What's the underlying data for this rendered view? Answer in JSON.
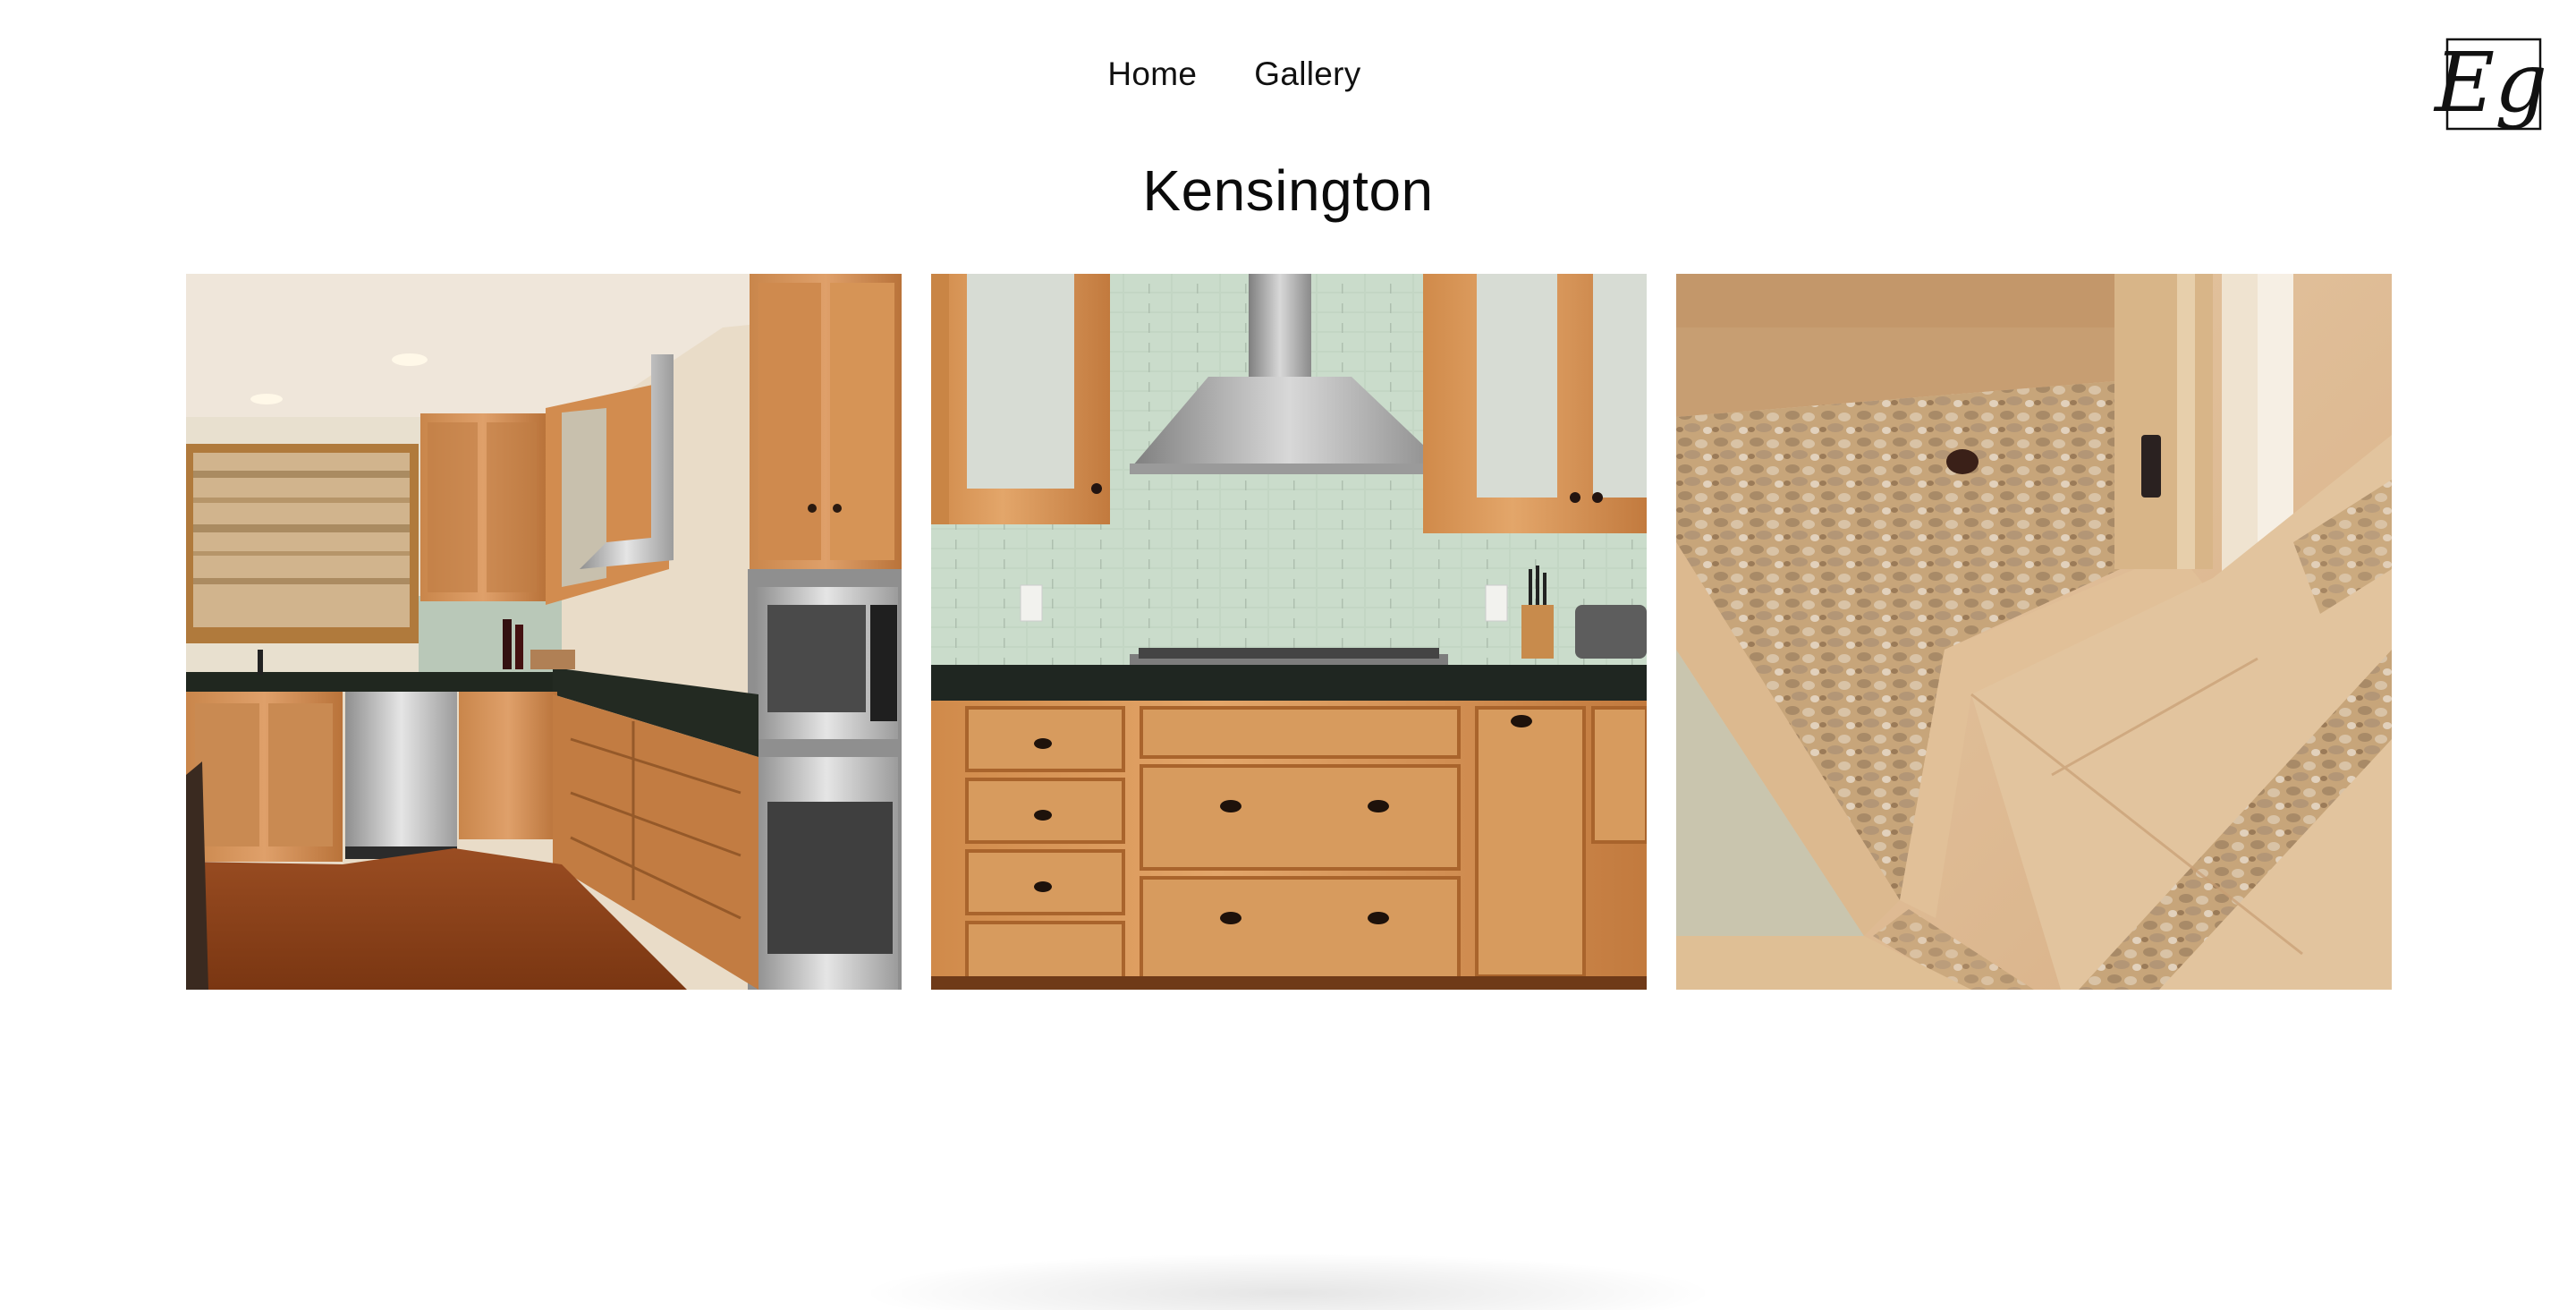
{
  "nav": {
    "items": [
      {
        "label": "Home"
      },
      {
        "label": "Gallery"
      }
    ]
  },
  "logo": {
    "text": "Eg"
  },
  "page": {
    "title": "Kensington"
  },
  "gallery": {
    "images": [
      {
        "subject": "kitchen-corner"
      },
      {
        "subject": "kitchen-range-hood"
      },
      {
        "subject": "pebble-shower"
      }
    ]
  }
}
